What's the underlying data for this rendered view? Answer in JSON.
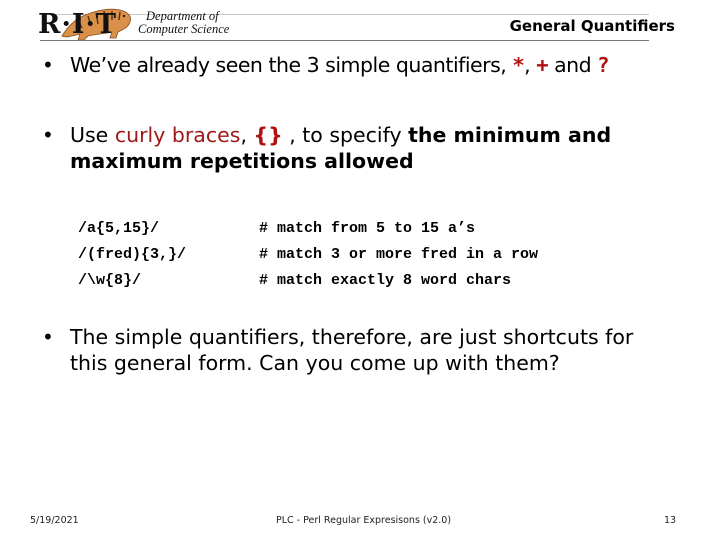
{
  "header": {
    "logo_letters": "R·I·T",
    "department_line1": "Department of",
    "department_line2": "Computer Science",
    "slide_title": "General Quantifiers"
  },
  "bullets": [
    {
      "parts": {
        "lead": "We’ve already seen the 3 simple quantifiers, ",
        "q1": "*",
        "sep1": ", ",
        "q2": "+",
        "sep2": " and ",
        "q3": "?"
      }
    },
    {
      "parts": {
        "lead": "Use ",
        "highlight": "curly braces",
        "sep1": ", ",
        "braces": "{}",
        "mid": " , to specify ",
        "bold_text": "the minimum and maximum repetitions allowed"
      }
    },
    {
      "text": "The simple quantifiers, therefore, are just shortcuts for this general form.  Can you come up with them?"
    }
  ],
  "code_examples": [
    {
      "pattern": "/a{5,15}/",
      "comment": "# match from 5 to 15 a’s"
    },
    {
      "pattern": "/(fred){3,}/",
      "comment": "# match 3 or more fred in a row"
    },
    {
      "pattern": "/\\w{8}/",
      "comment": "# match exactly 8 word chars"
    }
  ],
  "footer": {
    "date": "5/19/2021",
    "title": "PLC - Perl Regular Expresisons  (v2.0)",
    "page": "13"
  },
  "colors": {
    "accent_red": "#a01818"
  },
  "icons": {
    "logo": "tiger-logo-icon",
    "bullet": "bullet-dot-icon"
  }
}
